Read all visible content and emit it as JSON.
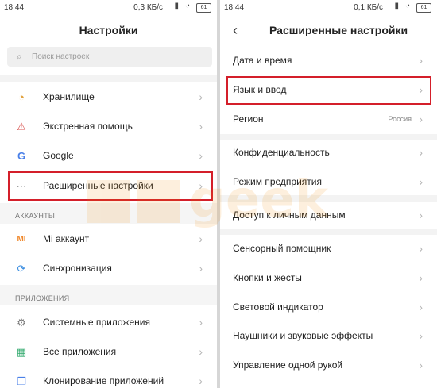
{
  "left": {
    "status": {
      "time": "18:44",
      "net": "0,3 КБ/с",
      "battery": "61"
    },
    "title": "Настройки",
    "search": {
      "placeholder": "Поиск настроек"
    },
    "items": [
      {
        "label": "Хранилище",
        "icon": "pie-chart-icon"
      },
      {
        "label": "Экстренная помощь",
        "icon": "warning-icon"
      },
      {
        "label": "Google",
        "icon": "google-icon"
      },
      {
        "label": "Расширенные настройки",
        "icon": "more-dots-icon"
      }
    ],
    "section_accounts": "АККАУНТЫ",
    "accounts": [
      {
        "label": "Mi аккаунт",
        "icon": "mi-icon"
      },
      {
        "label": "Синхронизация",
        "icon": "sync-icon"
      }
    ],
    "section_apps": "ПРИЛОЖЕНИЯ",
    "apps": [
      {
        "label": "Системные приложения",
        "icon": "gear-icon"
      },
      {
        "label": "Все приложения",
        "icon": "grid-icon"
      },
      {
        "label": "Клонирование приложений",
        "icon": "clone-icon"
      }
    ]
  },
  "right": {
    "status": {
      "time": "18:44",
      "net": "0,1 КБ/с",
      "battery": "61"
    },
    "title": "Расширенные настройки",
    "items": [
      {
        "label": "Дата и время"
      },
      {
        "label": "Язык и ввод"
      },
      {
        "label": "Регион",
        "value": "Россия"
      },
      {
        "label": "Конфиденциальность"
      },
      {
        "label": "Режим предприятия"
      },
      {
        "label": "Доступ к личным данным"
      },
      {
        "label": "Сенсорный помощник"
      },
      {
        "label": "Кнопки и жесты"
      },
      {
        "label": "Световой индикатор"
      },
      {
        "label": "Наушники и звуковые эффекты"
      },
      {
        "label": "Управление одной рукой"
      }
    ]
  },
  "watermark": "geek",
  "colors": {
    "highlight": "#d41f2a",
    "watermark": "#f08a00"
  }
}
